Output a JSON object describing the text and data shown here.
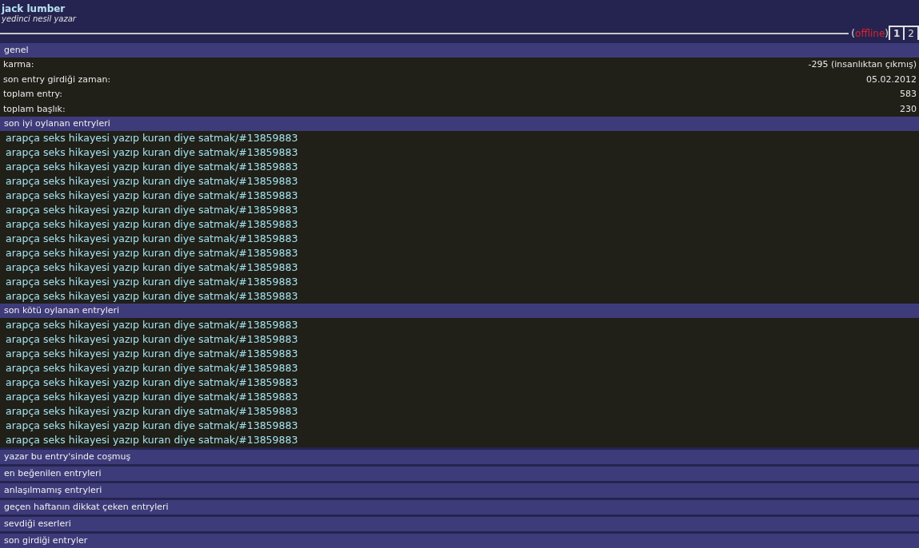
{
  "profile": {
    "name": "jack lumber",
    "rank": "yedinci nesil yazar"
  },
  "status": {
    "open": "(",
    "label": "offline",
    "close": ")",
    "online": false
  },
  "tabs": [
    {
      "label": "1",
      "selected": true
    },
    {
      "label": "2",
      "selected": false
    }
  ],
  "sections": [
    {
      "title": "genel",
      "kind": "stats",
      "expanded": true,
      "rows": [
        {
          "label": "karma:",
          "value": "-295 (insanlıktan çıkmış)"
        },
        {
          "label": "son entry girdiği zaman:",
          "value": "05.02.2012"
        },
        {
          "label": "toplam entry:",
          "value": "583"
        },
        {
          "label": "toplam başlık:",
          "value": "230"
        }
      ]
    },
    {
      "title": "son iyi oylanan entryleri",
      "kind": "links",
      "expanded": true,
      "entries": [
        "arapça seks hikayesi yazıp kuran diye satmak/#13859883",
        "arapça seks hikayesi yazıp kuran diye satmak/#13859883",
        "arapça seks hikayesi yazıp kuran diye satmak/#13859883",
        "arapça seks hikayesi yazıp kuran diye satmak/#13859883",
        "arapça seks hikayesi yazıp kuran diye satmak/#13859883",
        "arapça seks hikayesi yazıp kuran diye satmak/#13859883",
        "arapça seks hikayesi yazıp kuran diye satmak/#13859883",
        "arapça seks hikayesi yazıp kuran diye satmak/#13859883",
        "arapça seks hikayesi yazıp kuran diye satmak/#13859883",
        "arapça seks hikayesi yazıp kuran diye satmak/#13859883",
        "arapça seks hikayesi yazıp kuran diye satmak/#13859883",
        "arapça seks hikayesi yazıp kuran diye satmak/#13859883"
      ]
    },
    {
      "title": "son kötü oylanan entryleri",
      "kind": "links",
      "expanded": true,
      "entries": [
        "arapça seks hikayesi yazıp kuran diye satmak/#13859883",
        "arapça seks hikayesi yazıp kuran diye satmak/#13859883",
        "arapça seks hikayesi yazıp kuran diye satmak/#13859883",
        "arapça seks hikayesi yazıp kuran diye satmak/#13859883",
        "arapça seks hikayesi yazıp kuran diye satmak/#13859883",
        "arapça seks hikayesi yazıp kuran diye satmak/#13859883",
        "arapça seks hikayesi yazıp kuran diye satmak/#13859883",
        "arapça seks hikayesi yazıp kuran diye satmak/#13859883",
        "arapça seks hikayesi yazıp kuran diye satmak/#13859883"
      ]
    },
    {
      "title": "yazar bu entry'sinde coşmuş",
      "expanded": false
    },
    {
      "title": "en beğenilen entryleri",
      "expanded": false
    },
    {
      "title": "anlaşılmamış entryleri",
      "expanded": false
    },
    {
      "title": "geçen haftanın dikkat çeken entryleri",
      "expanded": false
    },
    {
      "title": "sevdiği eserleri",
      "expanded": false
    },
    {
      "title": "son girdiği entryler",
      "expanded": false
    }
  ]
}
